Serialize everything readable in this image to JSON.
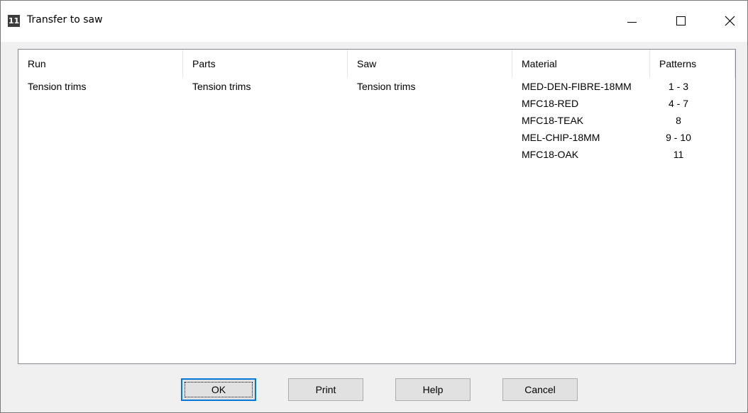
{
  "window": {
    "title": "Transfer to saw",
    "icon_text": "11",
    "icon": "app-icon",
    "controls": [
      "minimize-icon",
      "maximize-icon",
      "close-icon"
    ]
  },
  "list": {
    "columns": [
      "Run",
      "Parts",
      "Saw",
      "Material",
      "Patterns"
    ],
    "rows": [
      {
        "run": "Tension trims",
        "parts": "Tension trims",
        "saw": "Tension trims",
        "material": "MED-DEN-FIBRE-18MM",
        "patterns": "1 - 3"
      },
      {
        "run": "",
        "parts": "",
        "saw": "",
        "material": "MFC18-RED",
        "patterns": "4 - 7"
      },
      {
        "run": "",
        "parts": "",
        "saw": "",
        "material": "MFC18-TEAK",
        "patterns": "8"
      },
      {
        "run": "",
        "parts": "",
        "saw": "",
        "material": "MEL-CHIP-18MM",
        "patterns": "9 - 10"
      },
      {
        "run": "",
        "parts": "",
        "saw": "",
        "material": "MFC18-OAK",
        "patterns": "11"
      }
    ]
  },
  "buttons": {
    "ok": "OK",
    "print": "Print",
    "help": "Help",
    "cancel": "Cancel"
  },
  "colors": {
    "focus_border": "#0078d7",
    "button_face": "#e1e1e1",
    "dialog_background": "#f0f0f0"
  }
}
